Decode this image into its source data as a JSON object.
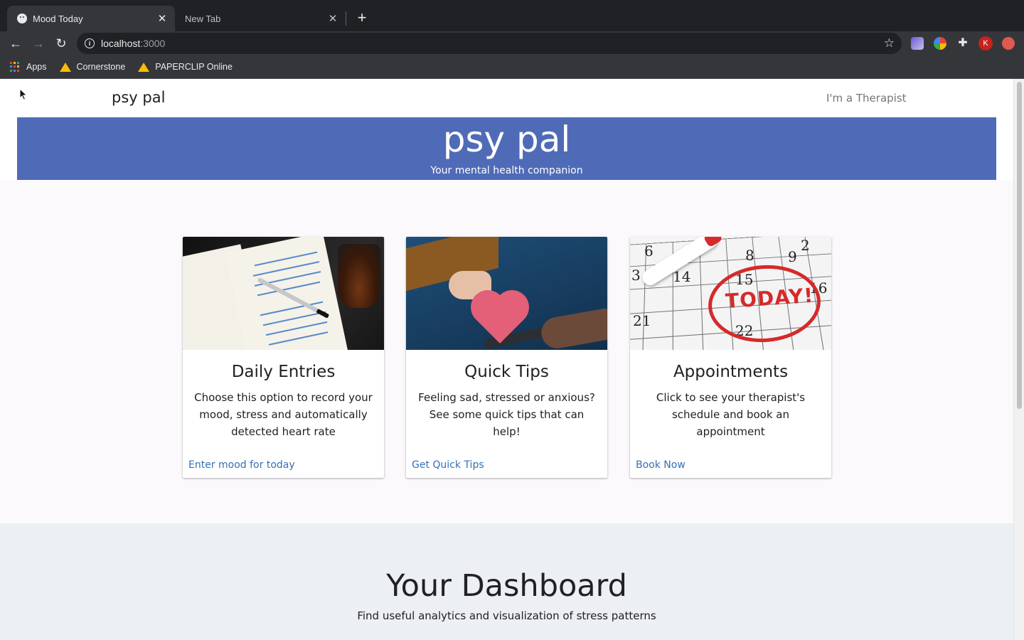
{
  "browser": {
    "tabs": [
      {
        "title": "Mood Today",
        "active": true
      },
      {
        "title": "New Tab",
        "active": false
      }
    ],
    "url_host": "localhost",
    "url_port": ":3000",
    "bookmarks": [
      {
        "label": "Apps",
        "icon": "apps-grid-icon"
      },
      {
        "label": "Cornerstone",
        "icon": "google-drive-icon"
      },
      {
        "label": "PAPERCLIP Online",
        "icon": "google-drive-icon"
      }
    ],
    "profile_initial": "K"
  },
  "navbar": {
    "brand": "psy pal",
    "therapist_link": "I'm a Therapist"
  },
  "hero": {
    "title": "psy pal",
    "subtitle": "Your mental health companion",
    "color": "#4f6bb7"
  },
  "cards": [
    {
      "title": "Daily Entries",
      "description": "Choose this option to record your mood, stress and automatically detected heart rate",
      "action": "Enter mood for today",
      "image": "journal-notebook-image"
    },
    {
      "title": "Quick Tips",
      "description": "Feeling sad, stressed or anxious? See some quick tips that can help!",
      "action": "Get Quick Tips",
      "image": "heart-handoff-image"
    },
    {
      "title": "Appointments",
      "description": "Click to see your therapist's schedule and book an appointment",
      "action": "Book Now",
      "image": "calendar-today-image"
    }
  ],
  "calendar_image_text": {
    "today": "TODAY!",
    "numbers": [
      "6",
      "8",
      "9",
      "2",
      "3",
      "14",
      "15",
      "16",
      "21",
      "22"
    ]
  },
  "dashboard": {
    "title": "Your Dashboard",
    "subtitle": "Find useful analytics and visualization of stress patterns"
  },
  "colors": {
    "link": "#3570b5",
    "chrome_dark": "#202124",
    "dashboard_bg": "#eceff4"
  }
}
